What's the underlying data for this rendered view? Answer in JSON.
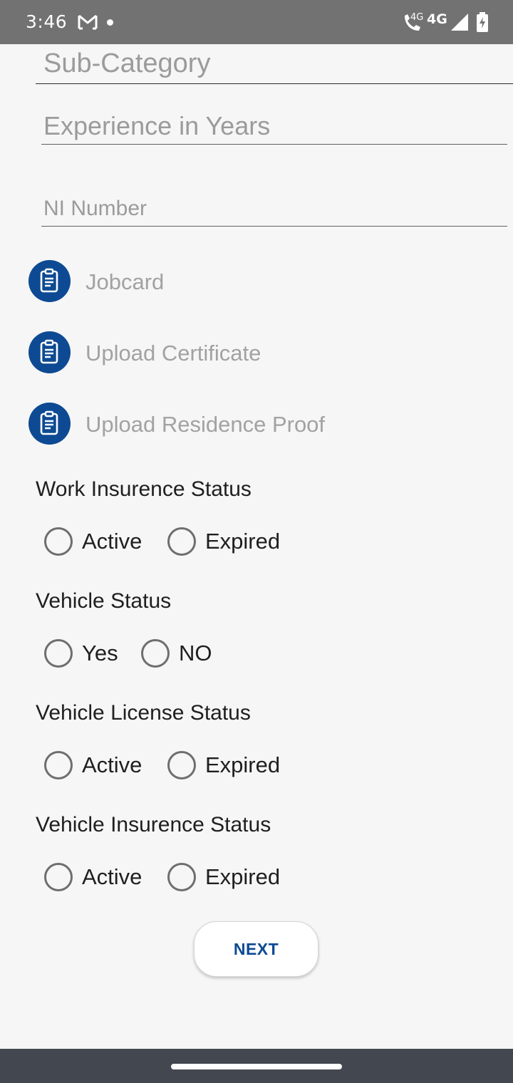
{
  "status_bar": {
    "time": "3:46",
    "call_tag": "4G",
    "network": "4G",
    "icons": [
      "gmail-icon",
      "notification-dot",
      "wifi-call-icon",
      "signal-icon",
      "battery-charging-icon"
    ]
  },
  "form": {
    "sub_category": {
      "placeholder": "Sub-Category"
    },
    "experience": {
      "placeholder": "Experience in Years"
    },
    "ni_number": {
      "placeholder": "NI Number"
    }
  },
  "uploads": [
    {
      "label": "Jobcard",
      "icon": "document-upload-icon"
    },
    {
      "label": "Upload Certificate",
      "icon": "document-upload-icon"
    },
    {
      "label": "Upload Residence Proof",
      "icon": "document-upload-icon"
    }
  ],
  "groups": [
    {
      "title": "Work Insurence Status",
      "options": [
        "Active",
        "Expired"
      ]
    },
    {
      "title": "Vehicle Status",
      "options": [
        "Yes",
        "NO"
      ]
    },
    {
      "title": "Vehicle License Status",
      "options": [
        "Active",
        "Expired"
      ]
    },
    {
      "title": "Vehicle Insurence Status",
      "options": [
        "Active",
        "Expired"
      ]
    }
  ],
  "next_button": {
    "label": "NEXT"
  },
  "colors": {
    "accent": "#0d4a93",
    "status_bar": "#727272",
    "nav_bar": "#434850",
    "background": "#f6f6f6"
  }
}
